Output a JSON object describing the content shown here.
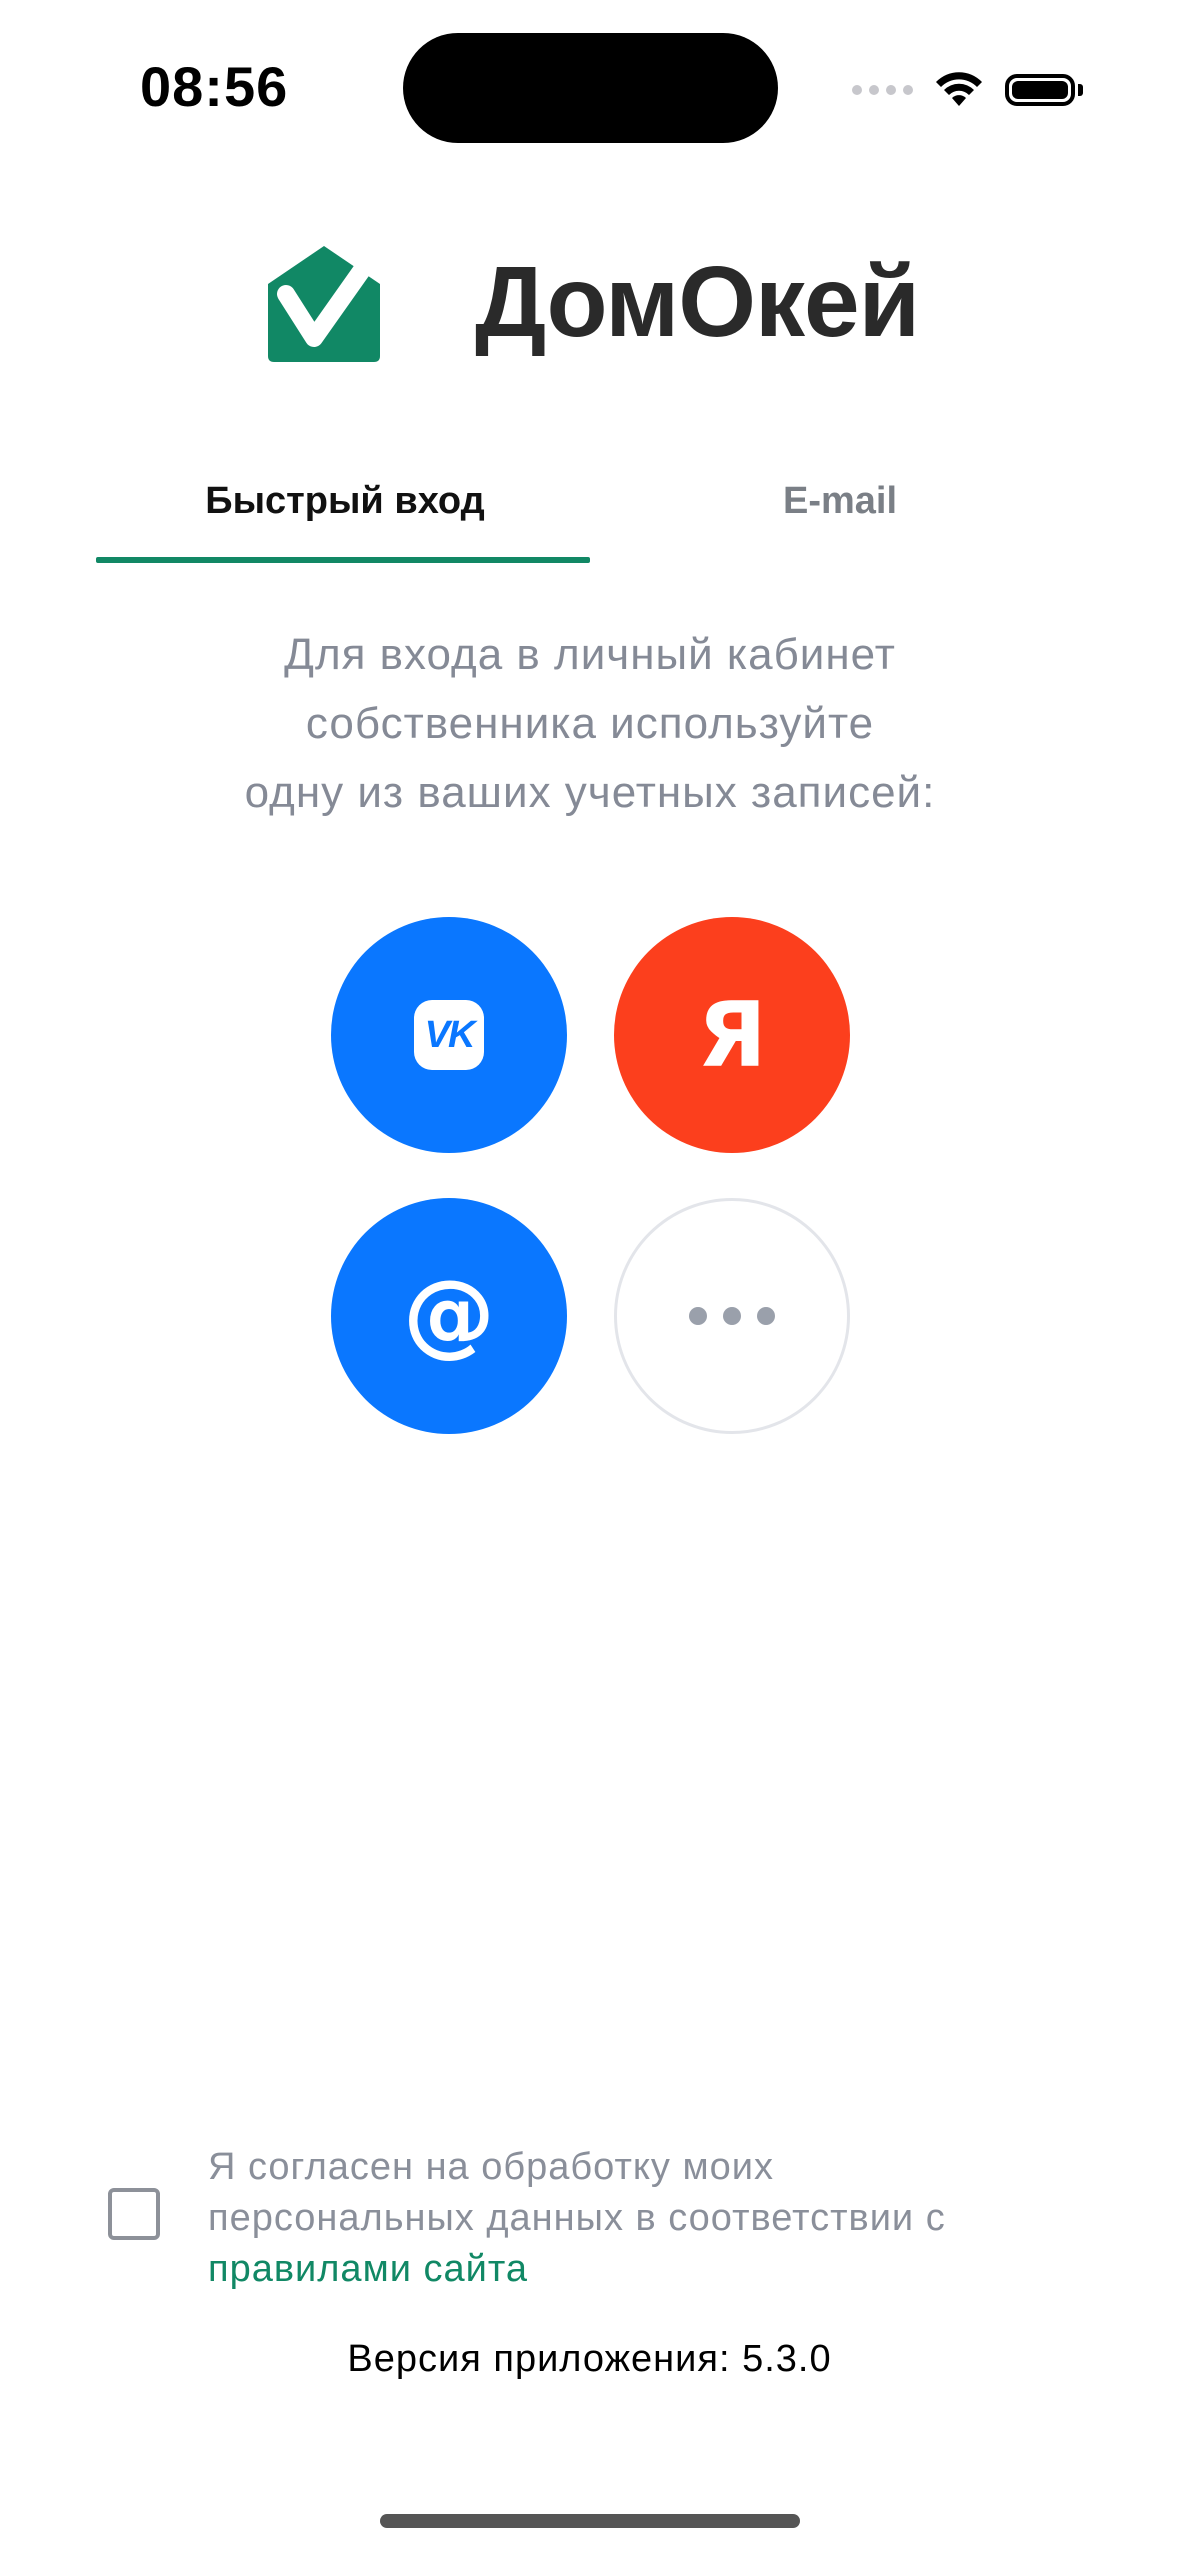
{
  "status_bar": {
    "time": "08:56"
  },
  "brand": {
    "name": "ДомОкей",
    "color": "#118865"
  },
  "tabs": [
    {
      "label": "Быстрый вход",
      "active": true
    },
    {
      "label": "E-mail",
      "active": false
    }
  ],
  "description": {
    "lines": [
      "Для входа в личный кабинет",
      "собственника используйте",
      "одну из ваших учетных записей:"
    ]
  },
  "login_options": [
    {
      "icon": "vk-icon",
      "glyph": "VK",
      "color": "#0a77ff"
    },
    {
      "icon": "yandex-icon",
      "glyph": "Я",
      "color": "#fc3f1d"
    },
    {
      "icon": "mail-ru-icon",
      "glyph": "@",
      "color": "#0a77ff"
    },
    {
      "icon": "more-icon",
      "glyph": "•••",
      "color": "#ffffff"
    }
  ],
  "consent": {
    "text_line1": "Я согласен на обработку моих",
    "text_line2": "персональных данных в соответствии с",
    "link": "правилами сайта",
    "checked": false
  },
  "footer": {
    "version": "Версия приложения: 5.3.0"
  }
}
